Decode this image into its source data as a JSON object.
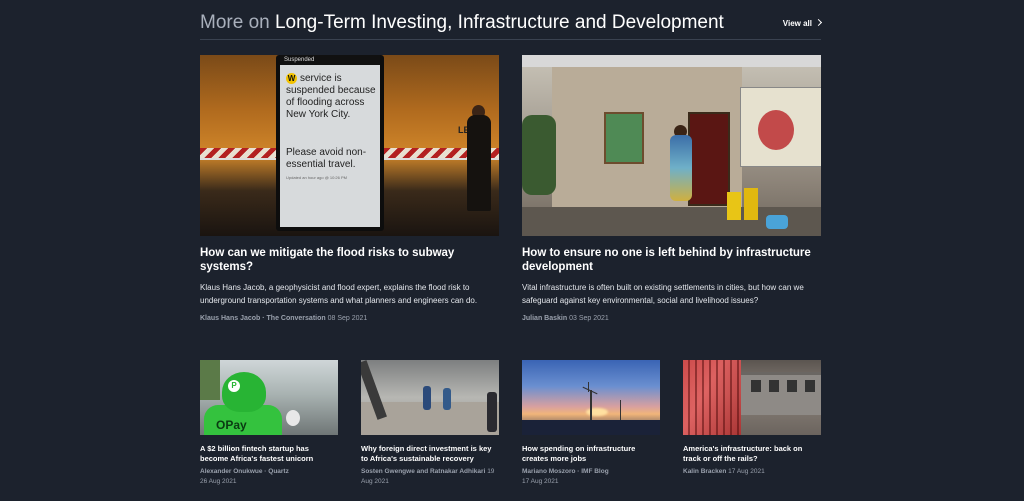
{
  "header": {
    "prefix": "More on",
    "topic": "Long-Term Investing, Infrastructure and Development",
    "view_all": "View all"
  },
  "featured": [
    {
      "title": "How can we mitigate the flood risks to subway systems?",
      "description": "Klaus Hans Jacob, a geophysicist and flood expert, explains the flood risk to underground transportation systems and what planners and engineers can do.",
      "author": "Klaus Hans Jacob · The Conversation",
      "date": "08 Sep 2021",
      "image": {
        "screen_top": "Suspended",
        "badge": "W",
        "text_line1": "service is suspended because of flooding across New York City.",
        "text_line2": "Please avoid non-essential travel.",
        "small": "Updated an hour ago @ 10:26 PM",
        "wall_text": "LEX"
      }
    },
    {
      "title": "How to ensure no one is left behind by infrastructure development",
      "description": "Vital infrastructure is often built on existing settlements in cities, but how can we safeguard against key environmental, social and livelihood issues?",
      "author": "Julian Baskin",
      "date": "03 Sep 2021"
    }
  ],
  "articles": [
    {
      "title": "A $2 billion fintech startup has become Africa's fastest unicorn",
      "author": "Alexander Onukwue · Quartz",
      "date": "26 Aug 2021",
      "image_text": "OPay"
    },
    {
      "title": "Why foreign direct investment is key to Africa's sustainable recovery",
      "author": "Sosten Gwengwe and Ratnakar Adhikari",
      "date": "19 Aug 2021"
    },
    {
      "title": "How spending on infrastructure creates more jobs",
      "author": "Mariano Moszoro · IMF Blog",
      "date": "17 Aug 2021"
    },
    {
      "title": "America's infrastructure: back on track or off the rails?",
      "author": "Kalin Bracken",
      "date": "17 Aug 2021"
    }
  ],
  "colors": {
    "background": "#1c222d",
    "muted_text": "#9aa1ad",
    "divider": "#3a4250"
  }
}
